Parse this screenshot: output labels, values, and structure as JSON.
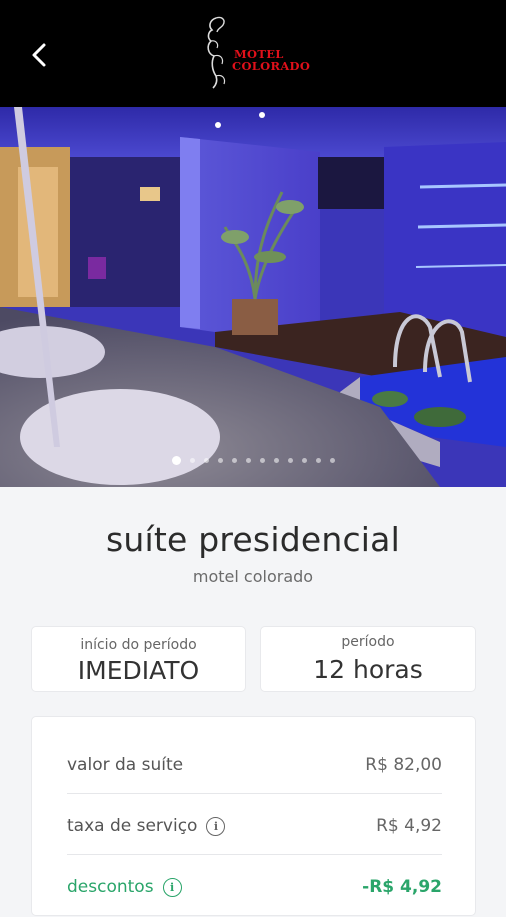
{
  "header": {
    "logo_line1": "MOTEL",
    "logo_line2": "COLORADO"
  },
  "gallery": {
    "total_images": 12,
    "current_index": 1
  },
  "suite": {
    "name": "suíte presidencial",
    "motel": "motel colorado"
  },
  "period_start": {
    "label": "início do período",
    "value": "IMEDIATO"
  },
  "period": {
    "label": "período",
    "value": "12 horas"
  },
  "pricing": {
    "suite_label": "valor da suíte",
    "suite_value": "R$ 82,00",
    "service_label": "taxa de serviço",
    "service_value": "R$ 4,92",
    "discount_label": "descontos",
    "discount_value": "-R$ 4,92"
  },
  "colors": {
    "header_bg": "#000000",
    "brand_red": "#e0101a",
    "discount_green": "#2aa56a",
    "page_bg": "#f4f5f7"
  },
  "icons": [
    "back-arrow-icon",
    "info-icon"
  ]
}
